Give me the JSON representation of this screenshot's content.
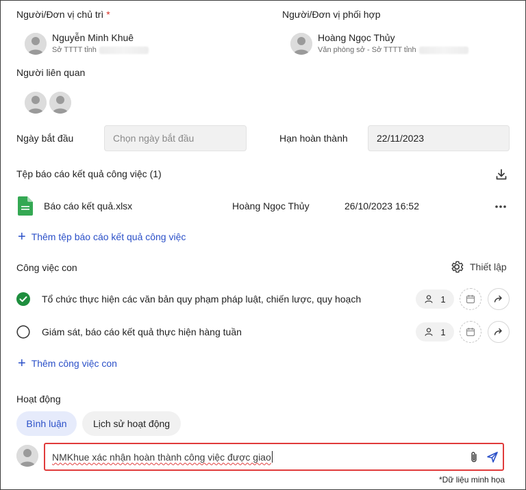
{
  "assignee": {
    "label": "Người/Đơn vị chủ trì",
    "required_mark": "*",
    "name": "Nguyễn Minh Khuê",
    "org": "Sở TTTT tỉnh"
  },
  "collaborator": {
    "label": "Người/Đơn vị phối hợp",
    "name": "Hoàng Ngọc Thủy",
    "org": "Văn phòng sở - Sở TTTT tỉnh"
  },
  "related": {
    "label": "Người liên quan"
  },
  "dates": {
    "start_label": "Ngày bắt đầu",
    "start_placeholder": "Chọn ngày bắt đầu",
    "due_label": "Hạn hoàn thành",
    "due_value": "22/11/2023"
  },
  "reports": {
    "title": "Tệp báo cáo kết quả công việc (1)",
    "files": [
      {
        "name": "Báo cáo kết quả.xlsx",
        "uploader": "Hoàng Ngọc Thủy",
        "time": "26/10/2023 16:52"
      }
    ],
    "add_label": "Thêm tệp báo cáo kết quả công việc"
  },
  "subtasks": {
    "title": "Công việc con",
    "settings_label": "Thiết lập",
    "items": [
      {
        "title": "Tổ chức thực hiện các văn bản quy phạm pháp luật, chiến lược, quy hoạch",
        "done": true,
        "assignees": "1"
      },
      {
        "title": "Giám sát, báo cáo kết quả thực hiện hàng tuần",
        "done": false,
        "assignees": "1"
      }
    ],
    "add_label": "Thêm công việc con"
  },
  "activity": {
    "title": "Hoạt động",
    "tabs": [
      "Bình luận",
      "Lịch sử hoạt động"
    ],
    "active_tab": 0,
    "comment_value": "NMKhue xác nhận hoàn thành công việc được giao"
  },
  "footnote": "*Dữ liệu minh họa",
  "colors": {
    "accent": "#2b50c8",
    "success": "#1e8e3e",
    "highlight": "#e03a3a",
    "file_green": "#34a853"
  }
}
